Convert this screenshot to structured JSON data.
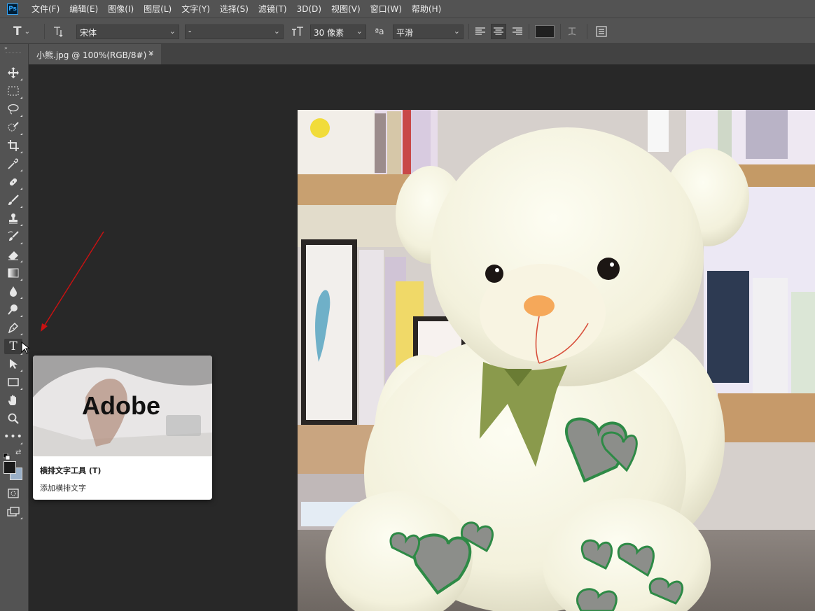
{
  "menubar": {
    "logo": "Ps",
    "items": [
      "文件(F)",
      "编辑(E)",
      "图像(I)",
      "图层(L)",
      "文字(Y)",
      "选择(S)",
      "滤镜(T)",
      "3D(D)",
      "视图(V)",
      "窗口(W)",
      "帮助(H)"
    ]
  },
  "options": {
    "tool_icon": "T",
    "font_family": "宋体",
    "font_style": "-",
    "font_size": "30 像素",
    "aa_label": "ªa",
    "anti_alias": "平滑",
    "text_color": "#202020"
  },
  "document": {
    "tab_title": "小熊.jpg @ 100%(RGB/8#) *",
    "close_glyph": "×"
  },
  "tools": [
    "move-icon",
    "marquee-icon",
    "lasso-icon",
    "quick-select-icon",
    "crop-icon",
    "eyedropper-icon",
    "healing-brush-icon",
    "brush-icon",
    "clone-stamp-icon",
    "history-brush-icon",
    "eraser-icon",
    "gradient-icon",
    "blur-icon",
    "dodge-icon",
    "pen-icon",
    "type-icon",
    "path-select-icon",
    "rectangle-icon",
    "hand-icon",
    "zoom-icon",
    "more-tools-icon"
  ],
  "tooltip": {
    "brand": "Adobe",
    "title": "横排文字工具 (T)",
    "description": "添加横排文字"
  },
  "colors": {
    "foreground": "#1a1a1a",
    "background": "#9ab0c8",
    "annotation": "#cc1111"
  }
}
